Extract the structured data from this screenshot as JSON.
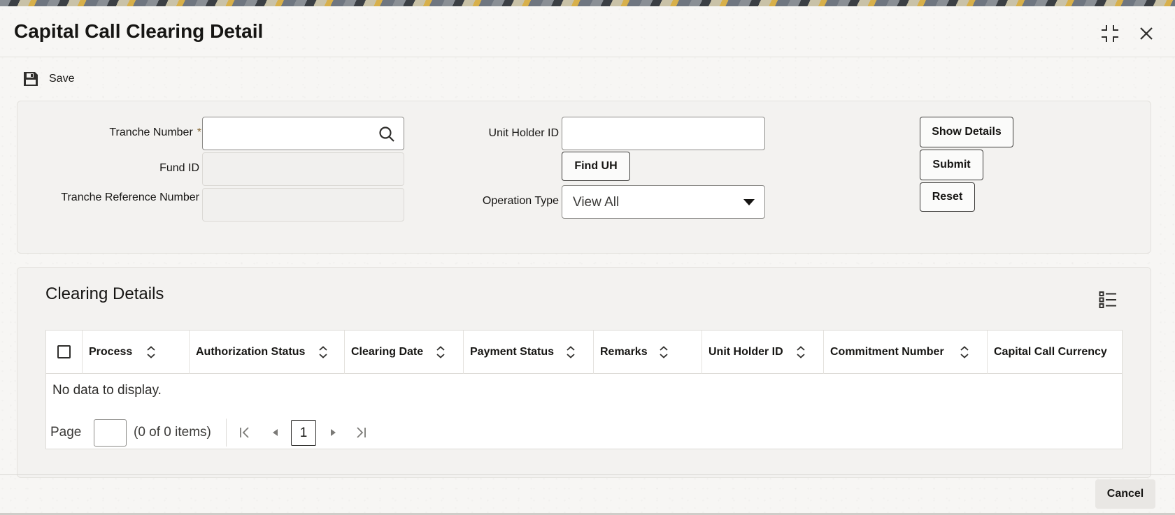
{
  "window": {
    "title": "Capital Call Clearing Detail",
    "colors": {
      "text": "#161513",
      "panel": "#f3f2f0",
      "border": "#8c8b88"
    }
  },
  "header": {
    "icons": [
      "collapse-icon",
      "close-icon"
    ]
  },
  "toolbar": {
    "save_label": "Save"
  },
  "form": {
    "tranche_number": {
      "label": "Tranche Number",
      "required_mark": "*",
      "value": ""
    },
    "fund_id": {
      "label": "Fund ID",
      "value": ""
    },
    "tranche_reference_number": {
      "label": "Tranche Reference Number",
      "value": ""
    },
    "unit_holder_id": {
      "label": "Unit Holder ID",
      "value": ""
    },
    "find_uh_label": "Find UH",
    "operation_type": {
      "label": "Operation Type",
      "value": "View All"
    },
    "show_details_label": "Show Details",
    "submit_label": "Submit",
    "reset_label": "Reset"
  },
  "clearing_details": {
    "title": "Clearing Details",
    "columns": [
      "Process",
      "Authorization Status",
      "Clearing Date",
      "Payment Status",
      "Remarks",
      "Unit Holder ID",
      "Commitment Number",
      "Capital Call Currency"
    ],
    "empty_text": "No data to display.",
    "pagination": {
      "page_label": "Page",
      "page_value": "",
      "count_text": "(0 of 0 items)",
      "current_page": "1"
    }
  },
  "footer": {
    "cancel_label": "Cancel"
  }
}
